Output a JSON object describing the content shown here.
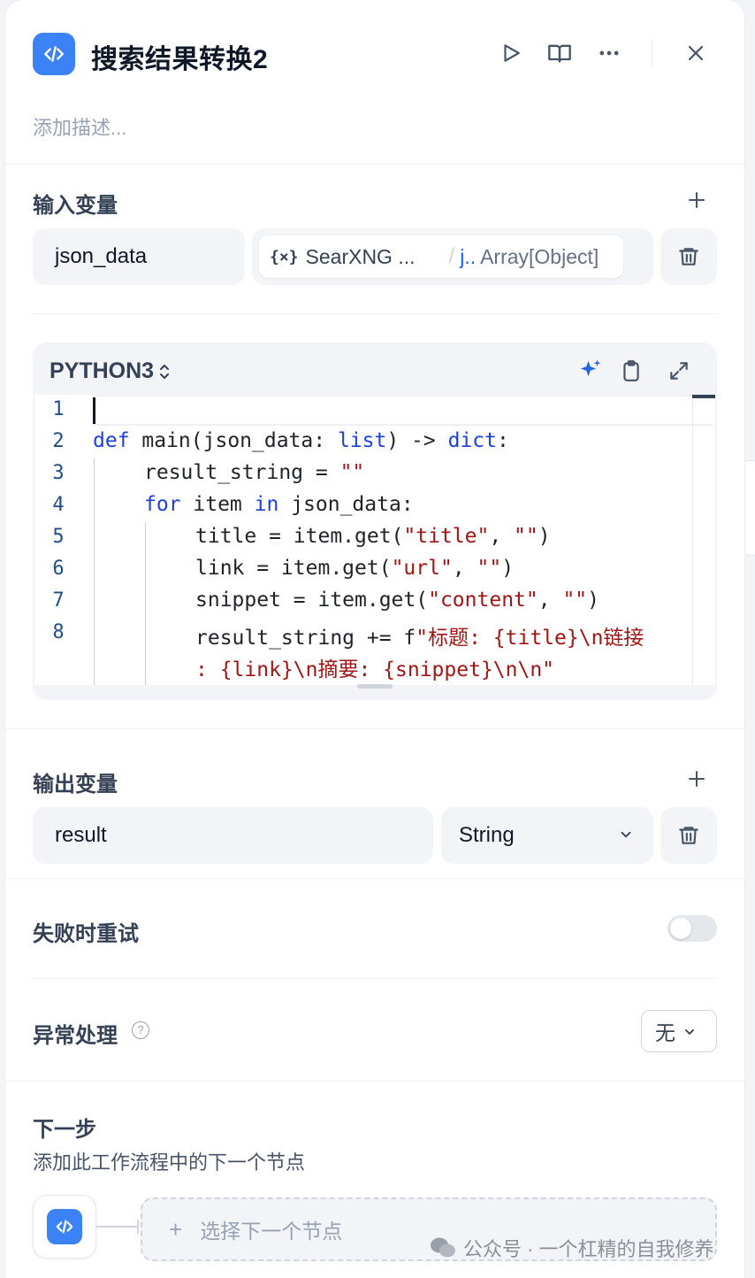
{
  "node": {
    "title": "搜索结果转换2",
    "description_placeholder": "添加描述...",
    "icon": "code-icon"
  },
  "header_actions": [
    "play-icon",
    "book-icon",
    "more-icon",
    "close-icon"
  ],
  "inputs": {
    "title": "输入变量",
    "variables": [
      {
        "name": "json_data",
        "source_node": "SearXNG ...",
        "source_var": "j..",
        "source_type": "Array[Object]"
      }
    ]
  },
  "code": {
    "language": "PYTHON3",
    "lines": [
      {
        "num": "1"
      },
      {
        "num": "2"
      },
      {
        "num": "3"
      },
      {
        "num": "4"
      },
      {
        "num": "5"
      },
      {
        "num": "6"
      },
      {
        "num": "7"
      },
      {
        "num": "8"
      }
    ],
    "text": {
      "l2": [
        "def",
        " main(json_data: ",
        "list",
        ") -> ",
        "dict",
        ":"
      ],
      "l3": [
        "result_string = ",
        "\"\""
      ],
      "l4": [
        "for",
        " item ",
        "in",
        " json_data:"
      ],
      "l5": [
        "title = item.get(",
        "\"title\"",
        ", ",
        "\"\"",
        ")"
      ],
      "l6": [
        "link = item.get(",
        "\"url\"",
        ", ",
        "\"\"",
        ")"
      ],
      "l7": [
        "snippet = item.get(",
        "\"content\"",
        ", ",
        "\"\"",
        ")"
      ],
      "l8": [
        "result_string += f",
        "\"标题: {title}\\n链接"
      ],
      "l8b": [
        ": {link}\\n摘要: {snippet}\\n\\n\""
      ]
    }
  },
  "outputs": {
    "title": "输出变量",
    "variables": [
      {
        "name": "result",
        "type": "String"
      }
    ]
  },
  "retry": {
    "label": "失败时重试",
    "enabled": false
  },
  "error_handling": {
    "label": "异常处理",
    "help": "?",
    "value": "无"
  },
  "next_step": {
    "title": "下一步",
    "description": "添加此工作流程中的下一个节点",
    "select_label": "选择下一个节点",
    "plus": "+"
  },
  "watermark": "公众号 · 一个杠精的自我修养",
  "colors": {
    "accent": "#3b82f6",
    "keyword": "#1d3fdc",
    "string": "#a31515",
    "line_number": "#1e4e8c"
  }
}
